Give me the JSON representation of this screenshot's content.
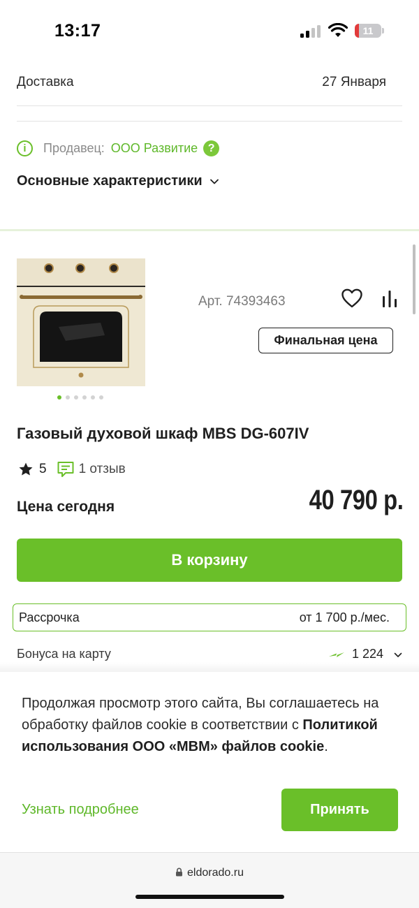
{
  "status_bar": {
    "time": "13:17",
    "battery_level": "11",
    "icons": [
      "cellular-signal-icon",
      "wifi-icon",
      "battery-icon"
    ]
  },
  "delivery": {
    "label": "Доставка",
    "date": "27 Января"
  },
  "seller": {
    "label": "Продавец:",
    "name": "ООО Развитие",
    "info_icon_glyph": "i",
    "help_icon_glyph": "?"
  },
  "specs": {
    "label": "Основные характеристики"
  },
  "product": {
    "article": "Арт. 74393463",
    "final_price_badge": "Финальная цена",
    "title": "Газовый духовой шкаф MBS DG-607IV",
    "image_count": 6,
    "active_image_index": 0,
    "rating": {
      "value": "5",
      "reviews": "1 отзыв"
    },
    "price_label": "Цена сегодня",
    "price": "40 790 р.",
    "cart_button": "В корзину",
    "installment": {
      "label": "Рассрочка",
      "value": "от 1 700 р./мес."
    },
    "bonus": {
      "label": "Бонуса на карту",
      "value": "1 224"
    }
  },
  "cookie_banner": {
    "text_part1": "Продолжая просмотр этого сайта, Вы соглашаетесь на обработку файлов cookie в соответствии с ",
    "text_link": "Политикой использования ООО «МВМ» файлов cookie",
    "text_end": ".",
    "learn_more": "Узнать подробнее",
    "accept": "Принять"
  },
  "browser": {
    "url": "eldorado.ru"
  },
  "colors": {
    "accent_green": "#6abf29",
    "link_green": "#5fb82a",
    "text_dark": "#1f1f1f",
    "text_muted": "#8a8a8a",
    "battery_low": "#e23b3b"
  }
}
